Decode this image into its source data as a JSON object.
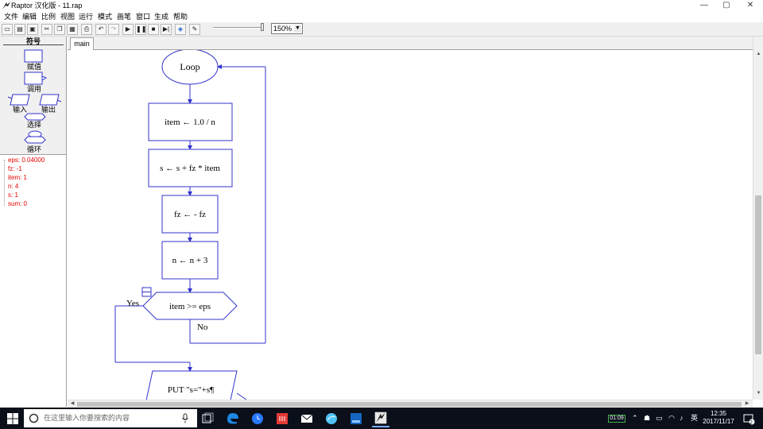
{
  "window": {
    "title": "Raptor 汉化版 - 11.rap",
    "minimize": "—",
    "restore": "▢",
    "close": "✕"
  },
  "menu": [
    "文件",
    "编辑",
    "比例",
    "视图",
    "运行",
    "模式",
    "画笔",
    "窗口",
    "生成",
    "帮助"
  ],
  "toolbar": {
    "buttons": [
      {
        "name": "new-icon",
        "glyph": "▭"
      },
      {
        "name": "open-icon",
        "glyph": "▤"
      },
      {
        "name": "save-icon",
        "glyph": "▣"
      },
      {
        "name": "cut-icon",
        "glyph": "✂"
      },
      {
        "name": "copy-icon",
        "glyph": "❐"
      },
      {
        "name": "paste-icon",
        "glyph": "▦"
      },
      {
        "name": "print-icon",
        "glyph": "⎙"
      },
      {
        "name": "undo-icon",
        "glyph": "↶"
      },
      {
        "name": "redo-icon",
        "glyph": "↷"
      },
      {
        "name": "play-icon",
        "glyph": "▶"
      },
      {
        "name": "pause-icon",
        "glyph": "❚❚"
      },
      {
        "name": "stop-icon",
        "glyph": "■"
      },
      {
        "name": "step-icon",
        "glyph": "▶|"
      },
      {
        "name": "breakpoint-icon",
        "glyph": "◈"
      },
      {
        "name": "pen-icon",
        "glyph": "✎"
      }
    ],
    "zoom_value": "150%",
    "zoom_level_percent": 100
  },
  "symbols": {
    "title": "符号",
    "assign": "赋值",
    "call": "调用",
    "input": "输入",
    "output": "输出",
    "selection": "选择",
    "loop": "循环"
  },
  "watch": [
    {
      "text": "eps: 0.04000"
    },
    {
      "text": "fz: -1"
    },
    {
      "text": "item: 1"
    },
    {
      "text": "n: 4"
    },
    {
      "text": "s: 1"
    },
    {
      "text": "sum: 0"
    }
  ],
  "tabs": [
    {
      "label": "main"
    }
  ],
  "flowchart": {
    "loop_label": "Loop",
    "steps": [
      "item ← 1.0 / n",
      "s ← s + fz * item",
      "fz ← - fz",
      "n ← n + 3"
    ],
    "decision": "item >= eps",
    "yes_label": "Yes",
    "no_label": "No",
    "output": "PUT \"s=\"+s¶"
  },
  "taskbar": {
    "search_placeholder": "在这里输入你要搜索的内容",
    "battery": "01:09",
    "ime": "英",
    "time": "12:35",
    "date": "2017/11/17",
    "notifications": "2"
  },
  "colors": {
    "flow_stroke": "#3333cc",
    "watch_text": "#e60000",
    "taskbar_bg": "#0a0f1a"
  }
}
